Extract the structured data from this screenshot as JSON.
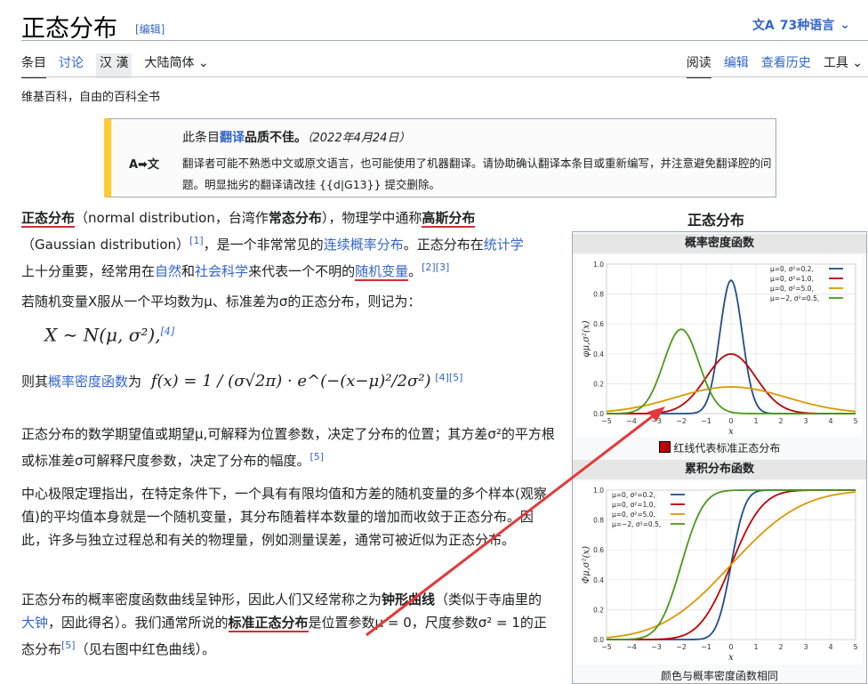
{
  "header": {
    "title": "正态分布",
    "edit_small": "[编辑]",
    "languages": "73种语言"
  },
  "tabs_left": [
    {
      "label": "条目"
    },
    {
      "label": "讨论"
    },
    {
      "label": "汉 漢"
    },
    {
      "label": "大陆简体"
    }
  ],
  "tabs_right": [
    {
      "label": "阅读"
    },
    {
      "label": "编辑"
    },
    {
      "label": "查看历史"
    },
    {
      "label": "工具"
    }
  ],
  "tagline": "维基百科，自由的百科全书",
  "notice": {
    "icon": "A➡文",
    "line1_a": "此条目",
    "line1_link": "翻译",
    "line1_b": "品质不佳。",
    "line1_date": "（2022年4月24日）",
    "line2": "翻译者可能不熟悉中文或原文语言，也可能使用了机器翻译。请协助确认翻译本条目或重新编写，并注意避免翻译腔的问题。明显拙劣的翻译请改挂 {{d|G13}} 提交删除。"
  },
  "paragraphs": {
    "p1a": "正态分布",
    "p1b": "（normal distribution，台湾作",
    "p1c": "常态分布",
    "p1d": "），物理学中通称",
    "p1e": "高斯分布",
    "p1f": "（Gaussian distribution）",
    "p1g": "，是一个非常常见的",
    "p1h": "连续概率分布",
    "p1i": "。正态分布在",
    "p1j": "统计学",
    "p1k": "上十分重要，经常用在",
    "p1l": "自然",
    "p1m": "和",
    "p1n": "社会科学",
    "p1o": "来代表一个不明的",
    "p1p": "随机变量",
    "p1q": "。",
    "p2": "若随机变量X服从一个平均数为μ、标准差为σ的正态分布，则记为：",
    "formula1": "X ∼ N(μ, σ²),",
    "p3a": "则其",
    "p3b": "概率密度函数",
    "p3c": "为",
    "formula2": "f(x) = 1 / (σ√2π) · e^(−(x−μ)²/2σ²)",
    "p4": "正态分布的数学期望值或期望μ,可解释为位置参数，决定了分布的位置；其方差σ²的平方根或标准差σ可解释尺度参数，决定了分布的幅度。",
    "p5": "中心极限定理指出，在特定条件下，一个具有有限均值和方差的随机变量的多个样本(观察值)的平均值本身就是一个随机变量，其分布随着样本数量的增加而收敛于正态分布。因此，许多与独立过程总和有关的物理量，例如测量误差，通常可被近似为正态分布。",
    "p6a": "正态分布的概率密度函数曲线呈钟形，因此人们又经常称之为",
    "p6b": "钟形曲线",
    "p6c": "（类似于寺庙里的",
    "p6d": "大钟",
    "p6e": "，因此得名）。我们通常所说的",
    "p6f": "标准正态分布",
    "p6g": "是位置参数μ = 0，尺度参数σ² = 1的正态分布",
    "p6h": "（见右图中红色曲线）。",
    "ref1": "[1]",
    "ref23": "[2][3]",
    "ref4": "[4]",
    "ref45": "[4][5]",
    "ref5": "[5]"
  },
  "infobox": {
    "title": "正态分布",
    "pdf_header": "概率密度函数",
    "pdf_caption": "红线代表标准正态分布",
    "cdf_header": "累积分布函数",
    "cdf_caption": "颜色与概率密度函数相同",
    "xlabel": "x",
    "pdf_ylabel": "φμ,σ²(x)",
    "cdf_ylabel": "Φμ,σ²(x)",
    "legend": [
      "μ=0,   σ²=0.2,",
      "μ=0,   σ²=1.0,",
      "μ=0,   σ²=5.0,",
      "μ=−2,  σ²=0.5,"
    ]
  },
  "chart_data": [
    {
      "type": "line",
      "title": "概率密度函数",
      "xlabel": "x",
      "ylabel": "φμ,σ²(x)",
      "xlim": [
        -5,
        5
      ],
      "ylim": [
        0,
        1.0
      ],
      "x_ticks": [
        -5,
        -4,
        -3,
        -2,
        -1,
        0,
        1,
        2,
        3,
        4,
        5
      ],
      "y_ticks": [
        0.0,
        0.2,
        0.4,
        0.6,
        0.8,
        1.0
      ],
      "series": [
        {
          "name": "μ=0, σ²=0.2",
          "color": "#1f4e8c",
          "mu": 0,
          "var": 0.2
        },
        {
          "name": "μ=0, σ²=1.0",
          "color": "#c00000",
          "mu": 0,
          "var": 1.0
        },
        {
          "name": "μ=0, σ²=5.0",
          "color": "#d89a00",
          "mu": 0,
          "var": 5.0
        },
        {
          "name": "μ=−2, σ²=0.5",
          "color": "#4a9a1a",
          "mu": -2,
          "var": 0.5
        }
      ]
    },
    {
      "type": "line",
      "title": "累积分布函数",
      "xlabel": "x",
      "ylabel": "Φμ,σ²(x)",
      "xlim": [
        -5,
        5
      ],
      "ylim": [
        0,
        1.0
      ],
      "x_ticks": [
        -5,
        -4,
        -3,
        -2,
        -1,
        0,
        1,
        2,
        3,
        4,
        5
      ],
      "y_ticks": [
        0.0,
        0.2,
        0.4,
        0.6,
        0.8,
        1.0
      ],
      "series": [
        {
          "name": "μ=0, σ²=0.2",
          "color": "#1f4e8c",
          "mu": 0,
          "var": 0.2
        },
        {
          "name": "μ=0, σ²=1.0",
          "color": "#c00000",
          "mu": 0,
          "var": 1.0
        },
        {
          "name": "μ=0, σ²=5.0",
          "color": "#d89a00",
          "mu": 0,
          "var": 5.0
        },
        {
          "name": "μ=−2, σ²=0.5",
          "color": "#4a9a1a",
          "mu": -2,
          "var": 0.5
        }
      ]
    }
  ]
}
